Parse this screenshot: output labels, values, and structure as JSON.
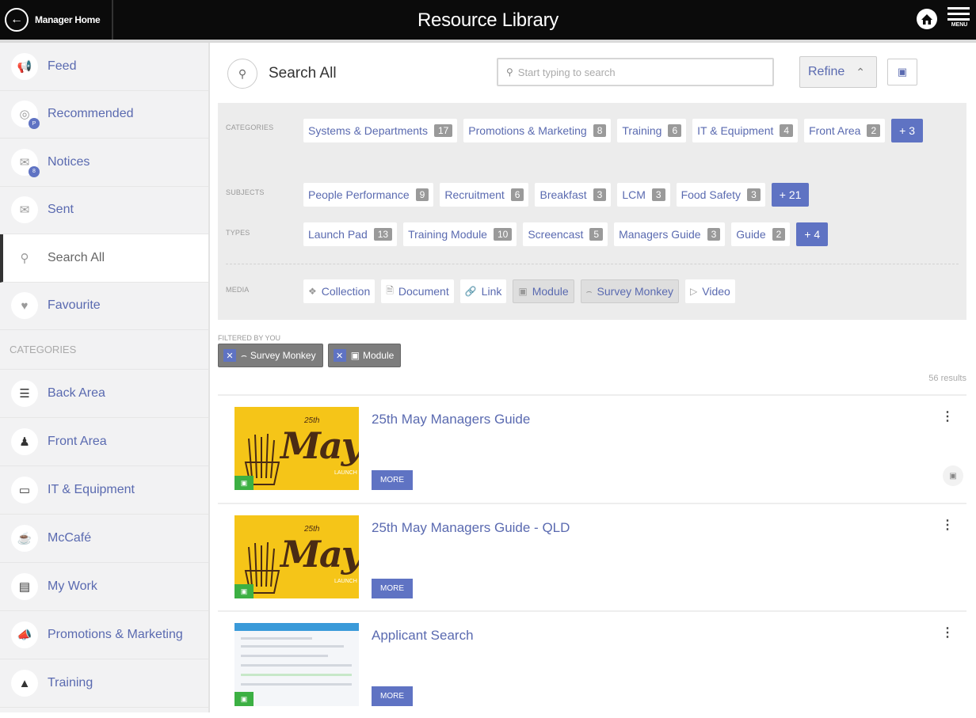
{
  "topbar": {
    "back_label": "Manager Home",
    "title": "Resource Library",
    "menu_label": "MENU"
  },
  "sidebar": {
    "items": [
      {
        "label": "Feed",
        "icon": "megaphone-icon"
      },
      {
        "label": "Recommended",
        "icon": "target-icon",
        "badge": "P"
      },
      {
        "label": "Notices",
        "icon": "envelope-icon",
        "badge": "8"
      },
      {
        "label": "Sent",
        "icon": "sent-mail-icon"
      },
      {
        "label": "Search All",
        "icon": "search-icon",
        "active": true
      },
      {
        "label": "Favourite",
        "icon": "heart-icon"
      }
    ],
    "categories_header": "CATEGORIES",
    "categories": [
      {
        "label": "Back Area",
        "icon": "burger-icon"
      },
      {
        "label": "Front Area",
        "icon": "cashier-icon"
      },
      {
        "label": "IT & Equipment",
        "icon": "monitor-icon"
      },
      {
        "label": "McCafé",
        "icon": "coffee-icon"
      },
      {
        "label": "My Work",
        "icon": "id-card-icon"
      },
      {
        "label": "Promotions & Marketing",
        "icon": "bullhorn-icon"
      },
      {
        "label": "Training",
        "icon": "graduation-cap-icon"
      }
    ]
  },
  "search": {
    "title": "Search All",
    "placeholder": "Start typing to search",
    "refine_label": "Refine"
  },
  "filters": {
    "categories_label": "CATEGORIES",
    "categories": [
      {
        "label": "Systems & Departments",
        "count": "17"
      },
      {
        "label": "Promotions & Marketing",
        "count": "8"
      },
      {
        "label": "Training",
        "count": "6"
      },
      {
        "label": "IT & Equipment",
        "count": "4"
      },
      {
        "label": "Front Area",
        "count": "2"
      }
    ],
    "categories_more": "+ 3",
    "subjects_label": "SUBJECTS",
    "subjects": [
      {
        "label": "People Performance",
        "count": "9"
      },
      {
        "label": "Recruitment",
        "count": "6"
      },
      {
        "label": "Breakfast",
        "count": "3"
      },
      {
        "label": "LCM",
        "count": "3"
      },
      {
        "label": "Food Safety",
        "count": "3"
      }
    ],
    "subjects_more": "+ 21",
    "types_label": "TYPES",
    "types": [
      {
        "label": "Launch Pad",
        "count": "13"
      },
      {
        "label": "Training Module",
        "count": "10"
      },
      {
        "label": "Screencast",
        "count": "5"
      },
      {
        "label": "Managers Guide",
        "count": "3"
      },
      {
        "label": "Guide",
        "count": "2"
      }
    ],
    "types_more": "+ 4",
    "media_label": "MEDIA",
    "media": [
      {
        "label": "Collection",
        "icon": "collection-icon",
        "selected": false
      },
      {
        "label": "Document",
        "icon": "document-icon",
        "selected": false
      },
      {
        "label": "Link",
        "icon": "link-icon",
        "selected": false
      },
      {
        "label": "Module",
        "icon": "module-icon",
        "selected": true
      },
      {
        "label": "Survey Monkey",
        "icon": "survey-monkey-icon",
        "selected": true
      },
      {
        "label": "Video",
        "icon": "video-icon",
        "selected": false
      }
    ]
  },
  "filtered_by_you": {
    "label": "FILTERED BY YOU",
    "chips": [
      {
        "label": "Survey Monkey",
        "icon": "survey-monkey-icon"
      },
      {
        "label": "Module",
        "icon": "module-icon"
      }
    ]
  },
  "results_count": "56 results",
  "results": [
    {
      "title": "25th May Managers Guide",
      "more_label": "MORE",
      "thumb_small": "25th",
      "thumb_big": "May",
      "thumb_launch": "LAUNCH"
    },
    {
      "title": "25th May Managers Guide - QLD",
      "more_label": "MORE",
      "thumb_small": "25th",
      "thumb_big": "May",
      "thumb_launch": "LAUNCH"
    },
    {
      "title": "Applicant Search",
      "more_label": "MORE"
    }
  ],
  "colors": {
    "accent": "#5f73c3",
    "topbar": "#0b0b0b",
    "link_text": "#5a6ab0",
    "thumb_yellow": "#f5c518",
    "module_badge": "#3cb043"
  }
}
